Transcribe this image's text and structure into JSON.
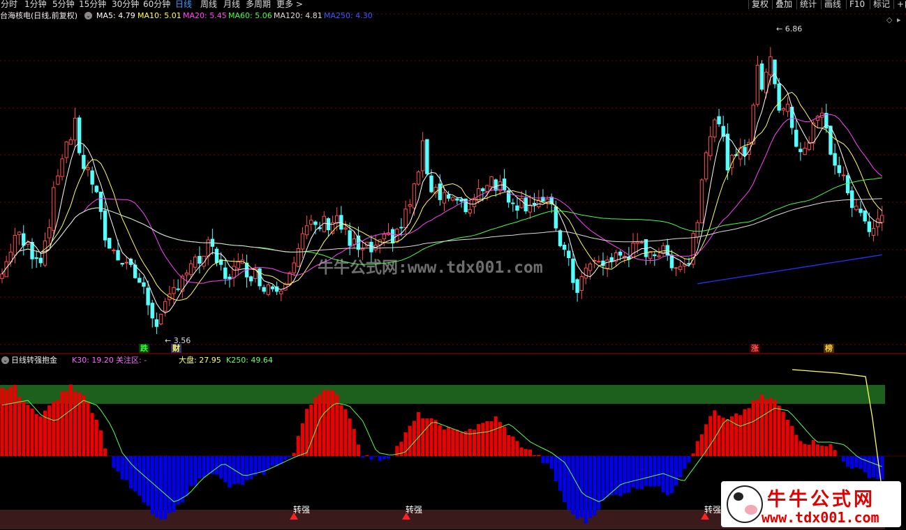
{
  "toolbar": {
    "periods": [
      "分时",
      "1分钟",
      "5分钟",
      "15分钟",
      "30分钟",
      "60分钟",
      "日线",
      "周线",
      "月线",
      "多周期",
      "更多 >"
    ],
    "active_period": "日线",
    "right_buttons": [
      "复权",
      "叠加",
      "统计",
      "画线",
      "F10",
      "标记"
    ],
    "right_edge": "+自"
  },
  "main_legend": {
    "title": "台海核电(日线,前复权)",
    "items": [
      {
        "label": "MA5:",
        "value": "4.79",
        "color": "#ffffff"
      },
      {
        "label": "MA10:",
        "value": "5.01",
        "color": "#ffff55"
      },
      {
        "label": "MA20:",
        "value": "5.45",
        "color": "#ff44ff"
      },
      {
        "label": "MA60:",
        "value": "5.06",
        "color": "#44ff44"
      },
      {
        "label": "MA120:",
        "value": "4.81",
        "color": "#dddddd"
      },
      {
        "label": "MA250:",
        "value": "4.30",
        "color": "#4455ff"
      }
    ]
  },
  "annotations": {
    "high": "6.86",
    "low": "3.56"
  },
  "markers": [
    {
      "text": "跌",
      "color": "#33ff33",
      "bg": "#004400"
    },
    {
      "text": "财",
      "color": "#ffff66",
      "bg": "#333366"
    },
    {
      "text": "涨",
      "color": "#ff5555",
      "bg": "#440000"
    },
    {
      "text": "榜",
      "color": "#ffcc33",
      "bg": "#443300"
    }
  ],
  "sub_legend": {
    "title": "日线转强抱金",
    "items": [
      {
        "label": "K30:",
        "value": "19.20",
        "color": "#ff66ff"
      },
      {
        "label": "关注区:",
        "value": "-",
        "color": "#ff66ff"
      },
      {
        "label": "大盘:",
        "value": "27.95",
        "color": "#ffff66"
      },
      {
        "label": "K250:",
        "value": "49.64",
        "color": "#66ff66"
      }
    ],
    "signal_label": "转强"
  },
  "watermark": {
    "center": "牛牛公式网:www.tdx001.com",
    "logo_text": "牛牛公式网",
    "logo_url": "www.tdx001.com"
  },
  "colors": {
    "up": "#ff4d4d",
    "down": "#54ffff",
    "ma5": "#ffffff",
    "ma10": "#ffff55",
    "ma20": "#ff44ff",
    "ma60": "#44ff44",
    "ma120": "#dddddd",
    "ma250": "#2233ff",
    "bar_pos": "#ee0000",
    "bar_neg": "#0000ee"
  },
  "chart_data": [
    {
      "type": "candlestick",
      "title": "台海核电(日线,前复权)",
      "price_min": 3.56,
      "price_max": 6.86,
      "ma_last": {
        "MA5": 4.79,
        "MA10": 5.01,
        "MA20": 5.45,
        "MA60": 5.06,
        "MA120": 4.81,
        "MA250": 4.3
      }
    },
    {
      "type": "bar",
      "title": "日线转强抱金",
      "series": [
        {
          "name": "K30",
          "last": 19.2
        },
        {
          "name": "大盘",
          "last": 27.95
        },
        {
          "name": "K250",
          "last": 49.64
        }
      ]
    }
  ]
}
